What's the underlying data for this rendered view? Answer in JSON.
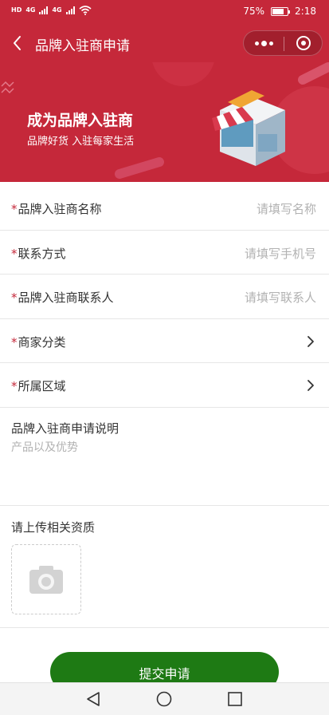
{
  "status_bar": {
    "network_labels": [
      "HD",
      "4G",
      "4G"
    ],
    "battery": "75%",
    "battery_level": 0.75,
    "time": "2:18",
    "wifi_icon": "wifi-icon"
  },
  "nav_bar": {
    "title": "品牌入驻商申请",
    "back_icon": "chevron-left-icon",
    "more_icon": "more-dots-icon",
    "close_icon": "target-close-icon",
    "background": "#c5283a"
  },
  "banner": {
    "title": "成为品牌入驻商",
    "subtitle": "品牌好货 入驻每家生活",
    "illustration": "store-icon"
  },
  "form": {
    "required_mark": "*",
    "fields": [
      {
        "label": "品牌入驻商名称",
        "required": true,
        "placeholder": "请填写名称",
        "type": "text"
      },
      {
        "label": "联系方式",
        "required": true,
        "placeholder": "请填写手机号",
        "type": "text"
      },
      {
        "label": "品牌入驻商联系人",
        "required": true,
        "placeholder": "请填写联系人",
        "type": "text"
      },
      {
        "label": "商家分类",
        "required": true,
        "placeholder": "",
        "type": "picker",
        "icon": "chevron-right-icon"
      },
      {
        "label": "所属区域",
        "required": true,
        "placeholder": "",
        "type": "picker",
        "icon": "chevron-right-icon"
      }
    ],
    "description": {
      "label": "品牌入驻商申请说明",
      "placeholder": "产品以及优势"
    },
    "upload": {
      "label": "请上传相关资质",
      "icon": "camera-icon"
    }
  },
  "submit": {
    "label": "提交申请",
    "color": "#1e7a14"
  },
  "system_nav": {
    "back_icon": "triangle-back-icon",
    "home_icon": "circle-home-icon",
    "recents_icon": "square-recents-icon"
  },
  "colors": {
    "accent": "#c5283a",
    "required": "#c5283a",
    "placeholder": "#b2b2b2",
    "divider": "#e6e6e6"
  }
}
